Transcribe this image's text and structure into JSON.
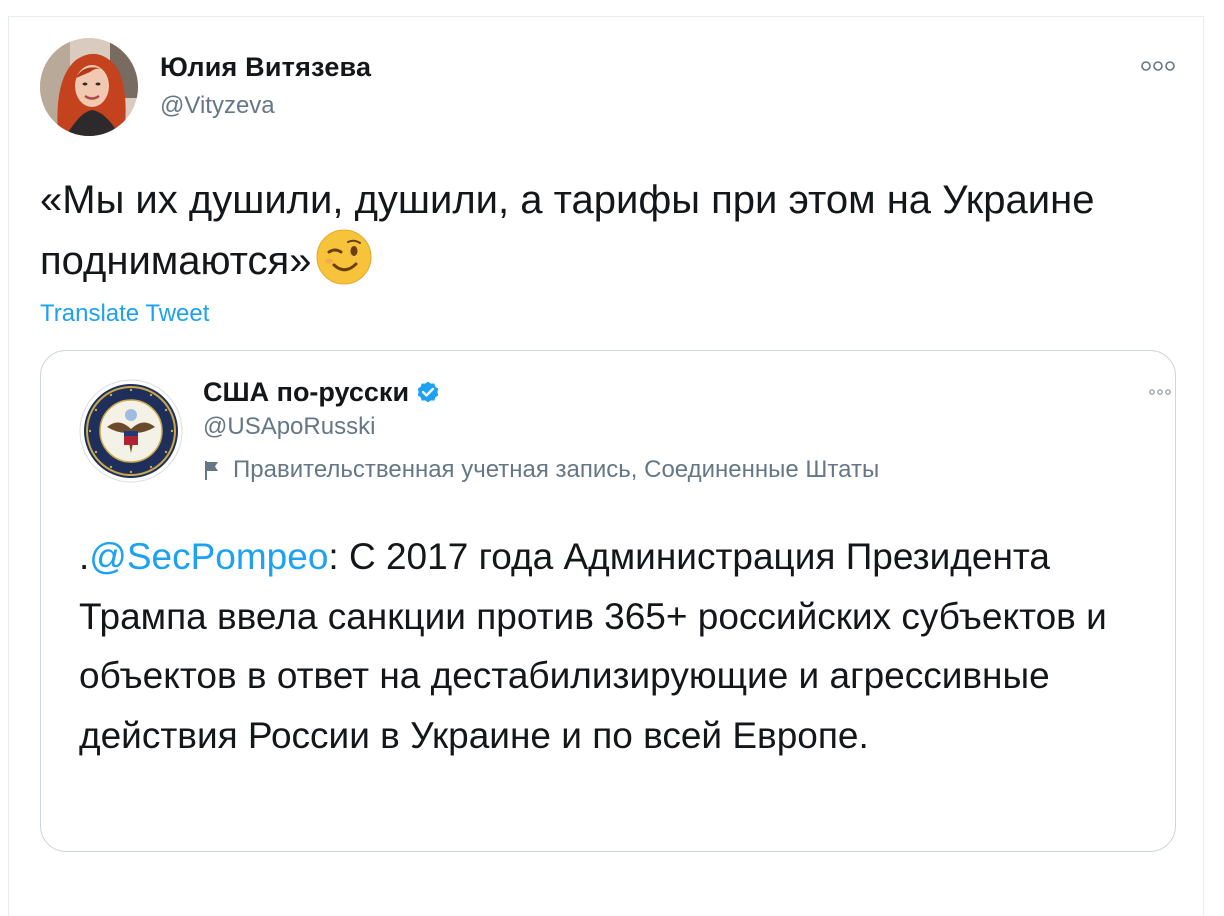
{
  "tweet": {
    "author_name": "Юлия Витязева",
    "author_handle": "@Vityzeva",
    "text": "«Мы их душили, душили, а тарифы при этом на Украине поднимаются»",
    "emoji": "winking-face",
    "translate_label": "Translate Tweet",
    "more_icon": "more-horizontal-icon"
  },
  "quoted_tweet": {
    "author_name": "США по-русски",
    "verified": true,
    "author_handle": "@USApoRusski",
    "account_label": "Правительственная учетная запись, Соединенные Штаты",
    "text_prefix": ".",
    "mention": "@SecPompeo",
    "text": ": С 2017 года Администрация Президента Трампа ввела санкции против 365+ российских субъектов и объектов в ответ на дестабилизирующие и агрессивные действия России в Украине и по всей Европе."
  },
  "colors": {
    "link": "#1da1f2",
    "text": "#14171a",
    "muted": "#657786",
    "border": "#ccd6dd"
  }
}
